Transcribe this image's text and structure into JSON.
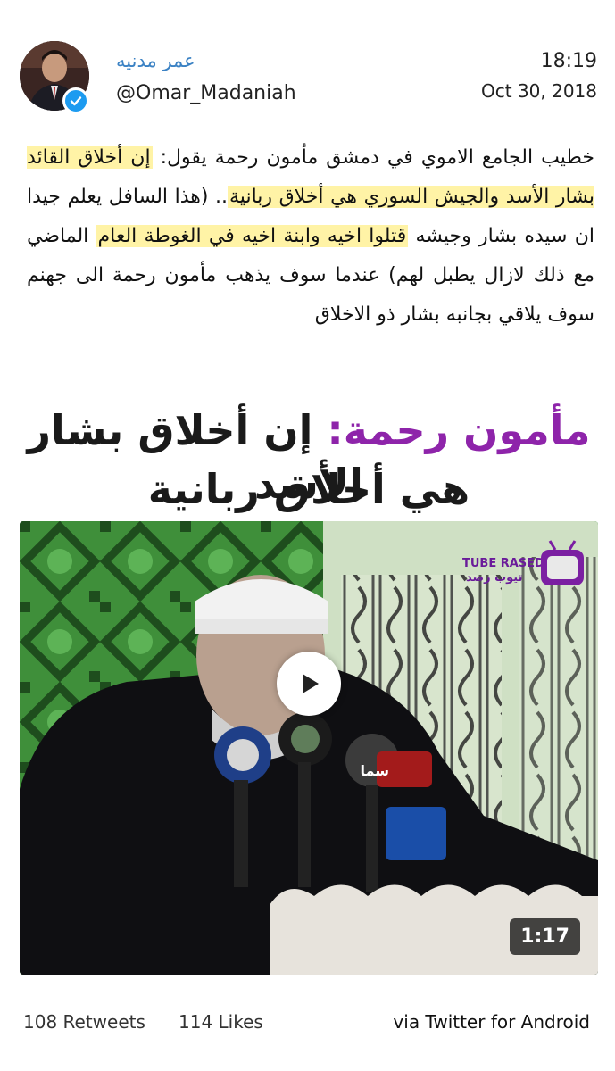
{
  "tweet": {
    "display_name": "عمر مدنيه",
    "handle": "@Omar_Madaniah",
    "time": "18:19",
    "date": "Oct 30, 2018",
    "text_parts": [
      {
        "text": "خطيب الجامع الاموي في دمشق مأمون رحمة يقول: ",
        "hl": false
      },
      {
        "text": "إن أخلاق القائد بشار الأسد والجيش السوري هي أخلاق ربانية",
        "hl": true
      },
      {
        "text": ".. (هذا السافل يعلم جيدا ان سيده بشار وجيشه ",
        "hl": false
      },
      {
        "text": "قتلوا اخيه وابنة اخيه في الغوطة العام",
        "hl": true
      },
      {
        "text": " الماضي مع ذلك لازال يطبل لهم) عندما سوف يذهب مأمون رحمة الى جهنم سوف يلاقي بجانبه بشار ذو الاخلاق",
        "hl": false
      }
    ]
  },
  "media": {
    "title_line1_name": "مأمون رحمة:",
    "title_line1_rest": " إن أخلاق بشار الأسد",
    "title_line2": "هي أخلاق ربانية",
    "watermark_en": "TUBE RASED",
    "watermark_ar": "تيوب رصد",
    "duration": "1:17",
    "mic_label": "سما"
  },
  "footer": {
    "retweets": "108 Retweets",
    "likes": "114 Likes",
    "source": "via Twitter for Android"
  },
  "colors": {
    "name_blue": "#3b82c4",
    "highlight": "#fff3a6",
    "title_purple": "#8e24aa",
    "verified": "#1d9bf0"
  }
}
